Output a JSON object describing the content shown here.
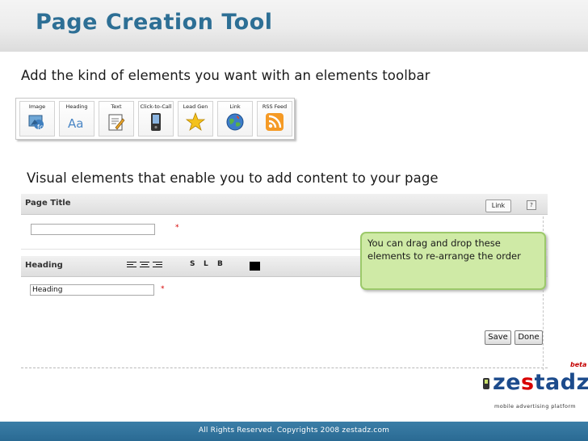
{
  "header": {
    "title": "Page Creation Tool"
  },
  "captions": {
    "toolbar_caption": "Add the kind of elements you want with an elements toolbar",
    "visual_caption": "Visual elements that enable you to add content to your page"
  },
  "toolbar": {
    "items": [
      {
        "label": "Image",
        "icon": "image-icon"
      },
      {
        "label": "Heading",
        "icon": "heading-icon"
      },
      {
        "label": "Text",
        "icon": "text-icon"
      },
      {
        "label": "Click-to-Call",
        "icon": "phone-icon"
      },
      {
        "label": "Lead Gen",
        "icon": "star-icon"
      },
      {
        "label": "Link",
        "icon": "globe-icon"
      },
      {
        "label": "RSS Feed",
        "icon": "rss-icon"
      }
    ]
  },
  "editor": {
    "page_title_label": "Page Title",
    "link_button": "Link",
    "help_button": "?",
    "page_title_value": "",
    "required_mark": "*",
    "heading_label": "Heading",
    "format_bold": "B",
    "format_small": "S",
    "format_large": "L",
    "heading_value": "Heading",
    "save_button": "Save",
    "done_button": "Done"
  },
  "callout": {
    "text": "You can drag and drop these elements to re-arrange the order"
  },
  "logo": {
    "beta": "beta",
    "wordmark": "zestadz",
    "tagline": "mobile advertising platform"
  },
  "footer": {
    "text": "All Rights Reserved. Copyrights 2008 zestadz.com"
  },
  "colors": {
    "title": "#2d6f95",
    "footer": "#2f7099",
    "callout_bg": "#cfeaa6",
    "required": "#d60000"
  }
}
